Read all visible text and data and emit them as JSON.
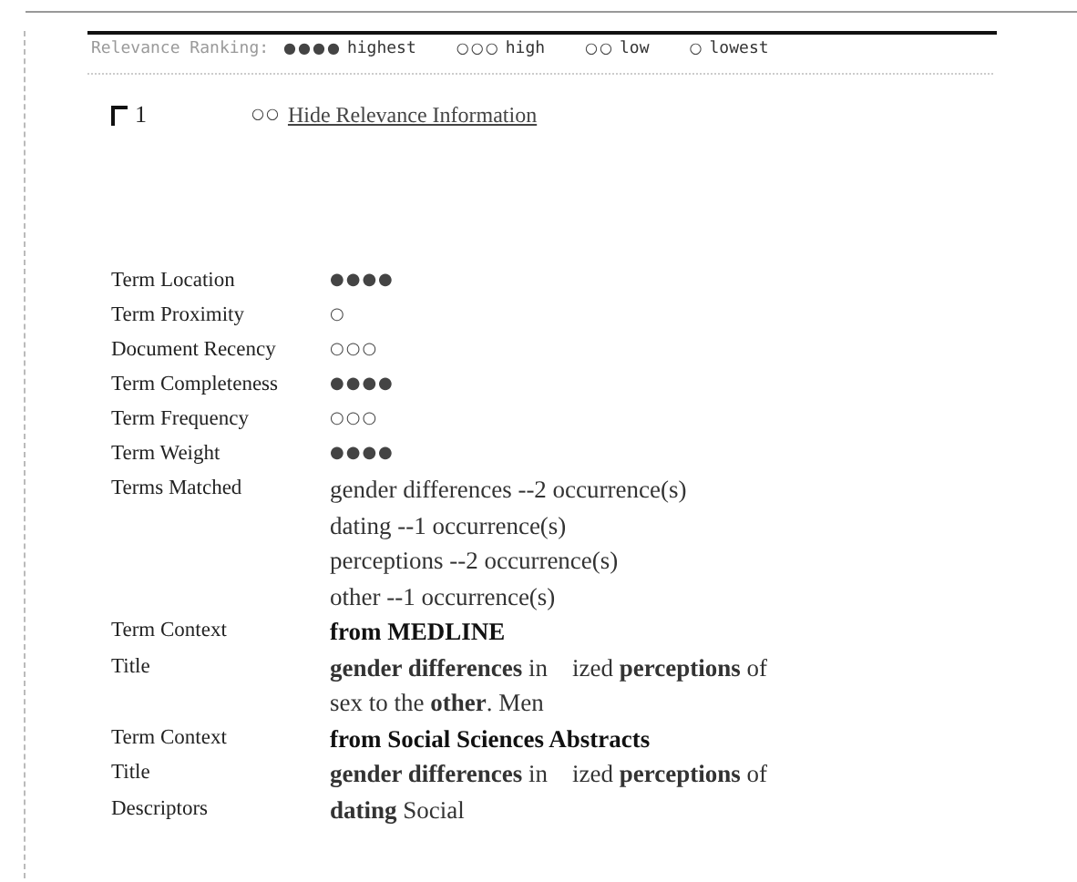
{
  "legend": {
    "title": "Relevance Ranking:",
    "items": [
      {
        "label": "highest",
        "dots": "●●●●"
      },
      {
        "label": "high",
        "dots": "○○○"
      },
      {
        "label": "low",
        "dots": "○○"
      },
      {
        "label": "lowest",
        "dots": "○"
      }
    ]
  },
  "result": {
    "checked": false,
    "number": "1",
    "link_dots": "○○",
    "link": "Hide Relevance Information"
  },
  "details": [
    {
      "kind": "rating",
      "label": "Term Location",
      "dots": "●●●●"
    },
    {
      "kind": "rating",
      "label": "Term Proximity",
      "dots": "○"
    },
    {
      "kind": "rating",
      "label": "Document Recency",
      "dots": "○○○"
    },
    {
      "kind": "rating",
      "label": "Term Completeness",
      "dots": "●●●●"
    },
    {
      "kind": "rating",
      "label": "Term Frequency",
      "dots": "○○○"
    },
    {
      "kind": "rating",
      "label": "Term Weight",
      "dots": "●●●●"
    },
    {
      "kind": "lines",
      "label": "Terms Matched",
      "lines": [
        "gender differences --2 occurrence(s)",
        "dating --1 occurrence(s)",
        "perceptions --2 occurrence(s)",
        "other --1 occurrence(s)"
      ]
    },
    {
      "kind": "heading",
      "label": "Term Context",
      "text": "from MEDLINE"
    },
    {
      "kind": "lines",
      "label": "Title",
      "lines": [
        "**gender differences** in    ized **perceptions** of",
        "sex to the **other**. Men"
      ]
    },
    {
      "kind": "heading",
      "label": "Term Context",
      "text": "from Social Sciences Abstracts"
    },
    {
      "kind": "lines",
      "label": "Title",
      "lines": [
        "**gender differences** in    ized **perceptions** of"
      ]
    },
    {
      "kind": "lines",
      "label": "Descriptors",
      "lines": [
        "**dating** Social"
      ]
    }
  ]
}
